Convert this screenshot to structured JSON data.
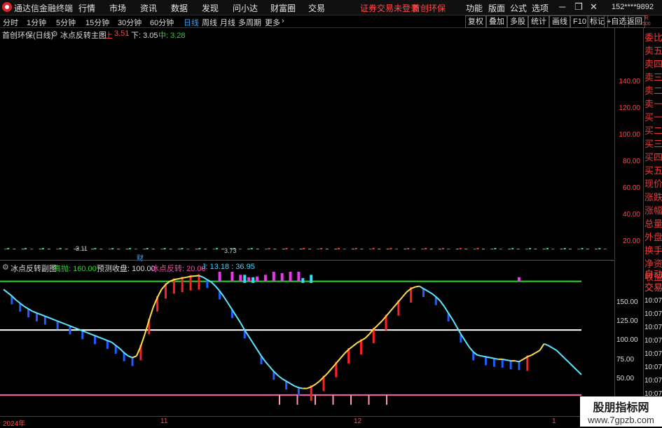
{
  "app": {
    "title": "通达信金融终端",
    "menu": [
      "行情",
      "市场",
      "资讯",
      "数据",
      "发现",
      "问小达",
      "财富圈",
      "交易"
    ],
    "notice": "证券交易未登录",
    "stock": "首创环保",
    "right_menu": [
      "功能",
      "版面",
      "公式",
      "选项"
    ],
    "user": "152****9892",
    "brand_color": "#d8262a"
  },
  "periods": {
    "items": [
      "分时",
      "1分钟",
      "5分钟",
      "15分钟",
      "30分钟",
      "60分钟",
      "日线",
      "周线",
      "月线",
      "多周期",
      "更多"
    ],
    "selected": "日线",
    "tools": [
      "复权",
      "叠加",
      "多股",
      "统计",
      "画线",
      "F10",
      "标记",
      "+自选",
      "返回"
    ]
  },
  "main_chart": {
    "label": "首创环保(日线)",
    "indicator": "冰点反转主图",
    "up_label": "上",
    "up_value": "3.51",
    "down_label": "下: 3.05",
    "mid_label": "中: 3.28",
    "price_labels": [
      "3.11",
      "3.73"
    ],
    "cai_label": "财",
    "y_ticks": [
      "140.00",
      "120.00",
      "100.00",
      "80.00",
      "60.00",
      "40.00",
      "20.00"
    ],
    "corner_r": "R",
    "corner_num": "500"
  },
  "sub_chart": {
    "indicator": "冰点反转副图",
    "gaopao_label": "高抛: 160.00",
    "yuce_label": "预测收盘: 100.00",
    "bingdian_label": "冰点反转: 20.00",
    "j_label": "J: 13.18 : 36.95",
    "y_ticks": [
      "150.00",
      "125.00",
      "100.00",
      "75.00",
      "50.00"
    ]
  },
  "x_axis": [
    "2024年",
    "11",
    "12",
    "1"
  ],
  "sidebar": {
    "items": [
      "委比",
      "卖五",
      "卖四",
      "卖三",
      "卖二",
      "卖一",
      "买一",
      "买二",
      "买三",
      "买四",
      "买五",
      "现价",
      "涨跌",
      "涨幅",
      "总量",
      "外盘",
      "换手",
      "净资",
      "收益"
    ],
    "auto": "自动",
    "trade": "交易",
    "times": [
      "10:07",
      "10:07",
      "10:07",
      "10:07",
      "10:07",
      "10:07",
      "10:07",
      "10:07"
    ]
  },
  "watermark": {
    "line1": "股朋指标网",
    "line2": "www.7gpzb.com"
  },
  "chart_data": {
    "type": "line",
    "y_range": [
      0,
      170
    ],
    "hlines": [
      {
        "value": 160,
        "color": "#22dd22"
      },
      {
        "value": 100,
        "color": "#ffffff"
      },
      {
        "value": 20,
        "color": "#ff5faf"
      }
    ],
    "x_count": 140,
    "series": [
      {
        "values": [
          150,
          146,
          142,
          137,
          133,
          129,
          126,
          123,
          121,
          119,
          117,
          115,
          113,
          111,
          109,
          107,
          105,
          103,
          101,
          99,
          97,
          95,
          93,
          91,
          89,
          87,
          85,
          81,
          77,
          72,
          68,
          66,
          68,
          80,
          95,
          112,
          128,
          140,
          150,
          156,
          160,
          162,
          163,
          164,
          165,
          166,
          166.5,
          167,
          165,
          162,
          159,
          154,
          148,
          141,
          133,
          125,
          117,
          109,
          100,
          92,
          84,
          76,
          68,
          61,
          55,
          49,
          44,
          40,
          37,
          34,
          31,
          29,
          28,
          28,
          30,
          33,
          37,
          42,
          47,
          53,
          59,
          65,
          71,
          76,
          80,
          84,
          87,
          90,
          95,
          101,
          106,
          111,
          117,
          123,
          129,
          135,
          141,
          147,
          151,
          153,
          154,
          151,
          148,
          145,
          141,
          136,
          129,
          121,
          113,
          104,
          95,
          87,
          79,
          73,
          69,
          68,
          67,
          66,
          65,
          64,
          64,
          63,
          62,
          62,
          61,
          64,
          67,
          69,
          72,
          75,
          83,
          81,
          78,
          75,
          70,
          65,
          60,
          55,
          50,
          45
        ]
      }
    ],
    "bars": {
      "values": [
        [
          2,
          168
        ],
        [
          4,
          162
        ],
        [
          6,
          158
        ],
        [
          8,
          152
        ],
        [
          10,
          145
        ],
        [
          13,
          138
        ],
        [
          16,
          131
        ],
        [
          19,
          126
        ],
        [
          22,
          118
        ],
        [
          25,
          108
        ],
        [
          27,
          102
        ],
        [
          29,
          95
        ],
        [
          31,
          86
        ],
        [
          33,
          80
        ],
        [
          35,
          89
        ],
        [
          37,
          103
        ],
        [
          39,
          118
        ],
        [
          41,
          134
        ],
        [
          43,
          146
        ],
        [
          45,
          152
        ],
        [
          47,
          158
        ],
        [
          49,
          167
        ],
        [
          52,
          165
        ],
        [
          55,
          160
        ],
        [
          58,
          155
        ],
        [
          62,
          145
        ],
        [
          65,
          126
        ],
        [
          68,
          110
        ],
        [
          71,
          91
        ],
        [
          74,
          74
        ],
        [
          77,
          57
        ],
        [
          80,
          46
        ],
        [
          83,
          38
        ],
        [
          86,
          34
        ],
        [
          89,
          36
        ],
        [
          92,
          42
        ],
        [
          95,
          49
        ],
        [
          98,
          56
        ],
        [
          101,
          63
        ],
        [
          104,
          70
        ],
        [
          107,
          76
        ],
        [
          110,
          80
        ],
        [
          113,
          86
        ],
        [
          116,
          94
        ],
        [
          118,
          103
        ],
        [
          120,
          112
        ],
        [
          122,
          125
        ],
        [
          124,
          132
        ],
        [
          126,
          140
        ]
      ],
      "colors": [
        "#ff2020",
        "#1f5fff",
        "#ffffff"
      ]
    },
    "magenta_bars": [
      [
        52,
        180
      ],
      [
        55,
        172
      ],
      [
        57,
        168
      ],
      [
        59,
        165
      ],
      [
        61,
        166
      ],
      [
        63,
        168
      ],
      [
        65,
        172
      ],
      [
        67,
        170
      ],
      [
        69,
        175
      ],
      [
        71,
        175
      ],
      [
        124,
        165
      ]
    ],
    "cyan_bars": [
      [
        58,
        168
      ],
      [
        60,
        165
      ],
      [
        72,
        164
      ],
      [
        74,
        168
      ]
    ],
    "bottom_bars": [
      [
        105,
        20
      ],
      [
        108,
        20
      ],
      [
        111,
        20
      ],
      [
        114,
        20
      ],
      [
        117,
        20
      ],
      [
        120,
        20
      ],
      [
        123,
        20
      ]
    ],
    "candles": [
      [
        1,
        3.05
      ],
      [
        5,
        3.04
      ],
      [
        9,
        3.06
      ],
      [
        13,
        3.1
      ],
      [
        17,
        3.08
      ],
      [
        21,
        3.12
      ],
      [
        25,
        3.11
      ],
      [
        29,
        3.09
      ],
      [
        33,
        3.07
      ],
      [
        37,
        3.11
      ],
      [
        41,
        3.13
      ],
      [
        45,
        3.12
      ],
      [
        49,
        3.14
      ],
      [
        53,
        3.15
      ],
      [
        57,
        3.17
      ],
      [
        61,
        3.73
      ],
      [
        65,
        3.72
      ],
      [
        69,
        3.66
      ],
      [
        73,
        3.6
      ],
      [
        77,
        3.55
      ],
      [
        81,
        3.5
      ],
      [
        85,
        3.45
      ],
      [
        89,
        3.4
      ],
      [
        93,
        3.38
      ],
      [
        97,
        3.36
      ],
      [
        101,
        3.34
      ],
      [
        105,
        3.32
      ],
      [
        109,
        3.3
      ],
      [
        113,
        3.29
      ],
      [
        117,
        3.27
      ],
      [
        121,
        3.24
      ],
      [
        125,
        3.22
      ],
      [
        129,
        3.2
      ],
      [
        133,
        3.19
      ],
      [
        137,
        3.18
      ]
    ]
  }
}
